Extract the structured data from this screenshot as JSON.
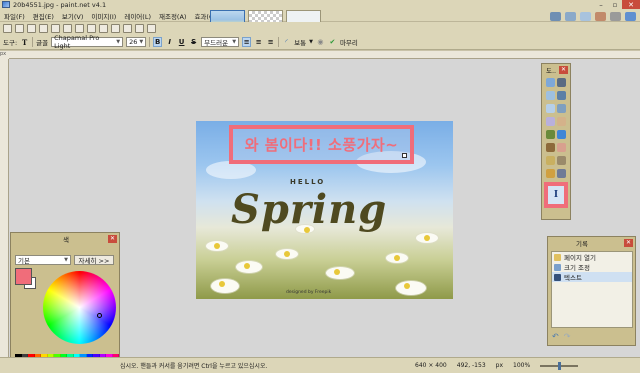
{
  "window": {
    "title": "20b4551.jpg - paint.net v4.1"
  },
  "menu": {
    "left": [
      "파일(F)",
      "편집(E)",
      "보기(V)",
      "이미지(I)",
      "레이어(L)",
      "재조정(A)",
      "효과(C)"
    ]
  },
  "toolbar2": {
    "tool_label": "도구:",
    "antialias_label": "글꼴",
    "font": "Chapamal Pro Light",
    "size": "26",
    "bold": "B",
    "italic": "I",
    "underline": "U",
    "strike": "S",
    "rendering": "부드러운",
    "blend": "보통",
    "finish": "마무리"
  },
  "canvas": {
    "overlay_text": "와 봄이다!! 소풍가자~",
    "hello": "HELLO",
    "spring": "Spring",
    "designed": "designed by Freepik"
  },
  "tools_panel": {
    "title": "도..",
    "selected_glyph": "I"
  },
  "history_panel": {
    "title": "기록",
    "items": [
      "페이지 열기",
      "크기 조정",
      "텍스트"
    ]
  },
  "colors_panel": {
    "title": "색",
    "mode": "기본",
    "more": "자세히 >>"
  },
  "status": {
    "message": "십시오. 핸들과 커서를 움기려면 Ctrl을 누르고 있으십시오.",
    "image_size": "640 × 400",
    "cursor": "492, -153",
    "unit": "px",
    "zoom": "100%"
  },
  "colors": {
    "accent": "#f06d7a",
    "primary": "#f06d7a",
    "secondary": "#ffffff"
  }
}
